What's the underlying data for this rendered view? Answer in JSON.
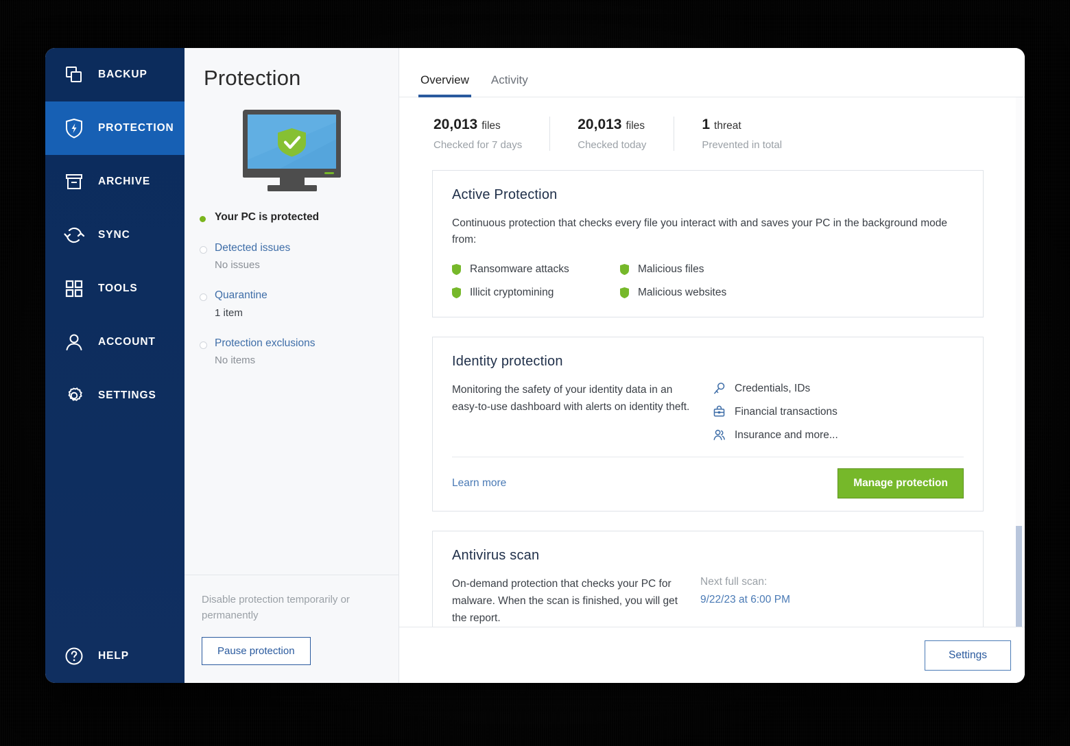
{
  "sidebar": {
    "items": [
      {
        "label": "BACKUP",
        "icon": "copy-icon",
        "active": false
      },
      {
        "label": "PROTECTION",
        "icon": "shield-bolt-icon",
        "active": true
      },
      {
        "label": "ARCHIVE",
        "icon": "archive-box-icon",
        "active": false
      },
      {
        "label": "SYNC",
        "icon": "sync-arrows-icon",
        "active": false
      },
      {
        "label": "TOOLS",
        "icon": "grid-squares-icon",
        "active": false
      },
      {
        "label": "ACCOUNT",
        "icon": "person-icon",
        "active": false
      },
      {
        "label": "SETTINGS",
        "icon": "gear-icon",
        "active": false
      }
    ],
    "help": {
      "label": "HELP",
      "icon": "question-circle-icon"
    }
  },
  "left_panel": {
    "title": "Protection",
    "illustration": "monitor-with-green-shield-icon",
    "status": {
      "main_label": "Your PC is protected",
      "main_dot_color": "#7ab51d"
    },
    "items": [
      {
        "label": "Detected issues",
        "value": "No issues"
      },
      {
        "label": "Quarantine",
        "value": "1 item"
      },
      {
        "label": "Protection exclusions",
        "value": "No items"
      }
    ],
    "footer": {
      "disable_text": "Disable protection temporarily or permanently",
      "pause_button": "Pause protection"
    }
  },
  "main": {
    "tabs": [
      {
        "label": "Overview",
        "active": true
      },
      {
        "label": "Activity",
        "active": false
      }
    ],
    "stats": [
      {
        "value": "20,013",
        "unit": "files",
        "sub": "Checked for 7 days"
      },
      {
        "value": "20,013",
        "unit": "files",
        "sub": "Checked today"
      },
      {
        "value": "1",
        "unit": "threat",
        "sub": "Prevented in total"
      }
    ],
    "active_protection": {
      "title": "Active Protection",
      "description": "Continuous protection that checks every file you interact with and saves your PC in the background mode from:",
      "features": [
        "Ransomware attacks",
        "Malicious files",
        "Illicit cryptomining",
        "Malicious websites"
      ]
    },
    "identity_protection": {
      "title": "Identity protection",
      "description": "Monitoring the safety of your identity data in an easy-to-use dashboard with alerts on identity theft.",
      "items": [
        {
          "label": "Credentials, IDs",
          "icon": "key-icon"
        },
        {
          "label": "Financial transactions",
          "icon": "briefcase-lock-icon"
        },
        {
          "label": "Insurance and more...",
          "icon": "people-icon"
        }
      ],
      "learn_more": "Learn more",
      "manage_button": "Manage protection"
    },
    "antivirus_scan": {
      "title": "Antivirus scan",
      "description": "On-demand protection that checks your PC for malware. When the scan is finished, you will get the report.",
      "next_scan_label": "Next full scan:",
      "next_scan_value": "9/22/23 at 6:00 PM"
    },
    "footer": {
      "settings_button": "Settings"
    }
  },
  "colors": {
    "sidebar_bg": "#0d2d5e",
    "sidebar_active": "#1760b4",
    "accent_blue": "#2a5a9e",
    "link_blue": "#4a7ab5",
    "green": "#76b82a",
    "status_green": "#7ab51d"
  }
}
